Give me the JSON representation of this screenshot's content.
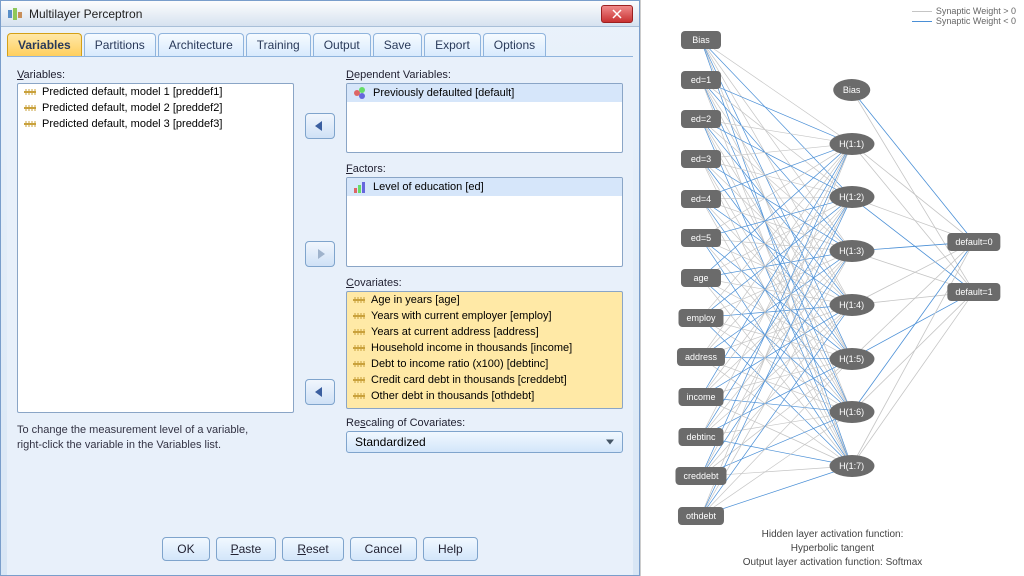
{
  "window": {
    "title": "Multilayer Perceptron"
  },
  "tabs": [
    {
      "label": "Variables",
      "active": true
    },
    {
      "label": "Partitions",
      "active": false
    },
    {
      "label": "Architecture",
      "active": false
    },
    {
      "label": "Training",
      "active": false
    },
    {
      "label": "Output",
      "active": false
    },
    {
      "label": "Save",
      "active": false
    },
    {
      "label": "Export",
      "active": false
    },
    {
      "label": "Options",
      "active": false
    }
  ],
  "labels": {
    "variables": "Variables:",
    "dependent": "Dependent Variables:",
    "factors": "Factors:",
    "covariates": "Covariates:",
    "rescaling": "Rescaling of Covariates:",
    "hint1": "To change the measurement level of a variable,",
    "hint2": "right-click the variable in the Variables list."
  },
  "variables_list": [
    "Predicted default, model 1 [preddef1]",
    "Predicted default, model 2 [preddef2]",
    "Predicted default, model 3 [preddef3]"
  ],
  "dependent": [
    "Previously defaulted [default]"
  ],
  "factors": [
    "Level of education [ed]"
  ],
  "covariates": [
    "Age in years [age]",
    "Years with current employer [employ]",
    "Years at current address [address]",
    "Household income in thousands [income]",
    "Debt to income ratio (x100) [debtinc]",
    "Credit card debt in thousands [creddebt]",
    "Other debt in thousands [othdebt]"
  ],
  "rescaling_value": "Standardized",
  "buttons": {
    "ok": "OK",
    "paste": "Paste",
    "reset": "Reset",
    "cancel": "Cancel",
    "help": "Help"
  },
  "legend": {
    "pos": "Synaptic Weight > 0",
    "neg": "Synaptic Weight < 0"
  },
  "nn": {
    "input": [
      "Bias",
      "ed=1",
      "ed=2",
      "ed=3",
      "ed=4",
      "ed=5",
      "age",
      "employ",
      "address",
      "income",
      "debtinc",
      "creddebt",
      "othdebt"
    ],
    "hidden": [
      "Bias",
      "H(1:1)",
      "H(1:2)",
      "H(1:3)",
      "H(1:4)",
      "H(1:5)",
      "H(1:6)",
      "H(1:7)"
    ],
    "output": [
      "default=0",
      "default=1"
    ]
  },
  "caption": {
    "l1": "Hidden layer activation function: Hyperbolic tangent",
    "l2": "Output layer activation function: Softmax"
  },
  "colors": {
    "pos": "#c5c5c5",
    "neg": "#4a8fd6"
  }
}
